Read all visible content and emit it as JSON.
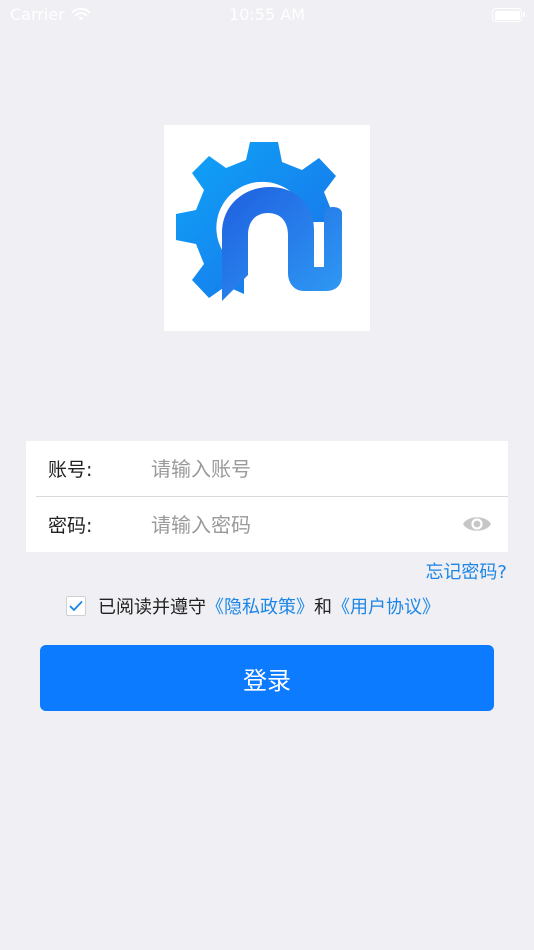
{
  "status_bar": {
    "carrier": "Carrier",
    "time": "10:55 AM",
    "wifi_icon": "wifi-icon",
    "battery_icon": "battery-icon"
  },
  "logo": {
    "icon": "app-logo-gear-n-icon"
  },
  "form": {
    "account": {
      "label": "账号:",
      "placeholder": "请输入账号",
      "value": ""
    },
    "password": {
      "label": "密码:",
      "placeholder": "请输入密码",
      "value": "",
      "toggle_icon": "eye-icon"
    }
  },
  "forgot_password": "忘记密码?",
  "agreement": {
    "checked": true,
    "prefix": "已阅读并遵守",
    "privacy_link": "《隐私政策》",
    "conjunction": "和",
    "user_agreement_link": "《用户协议》"
  },
  "login_button": "登录",
  "colors": {
    "background": "#efeff4",
    "primary": "#0c7bff",
    "link": "#1c86e6",
    "logo_blue": "#1593f5"
  }
}
